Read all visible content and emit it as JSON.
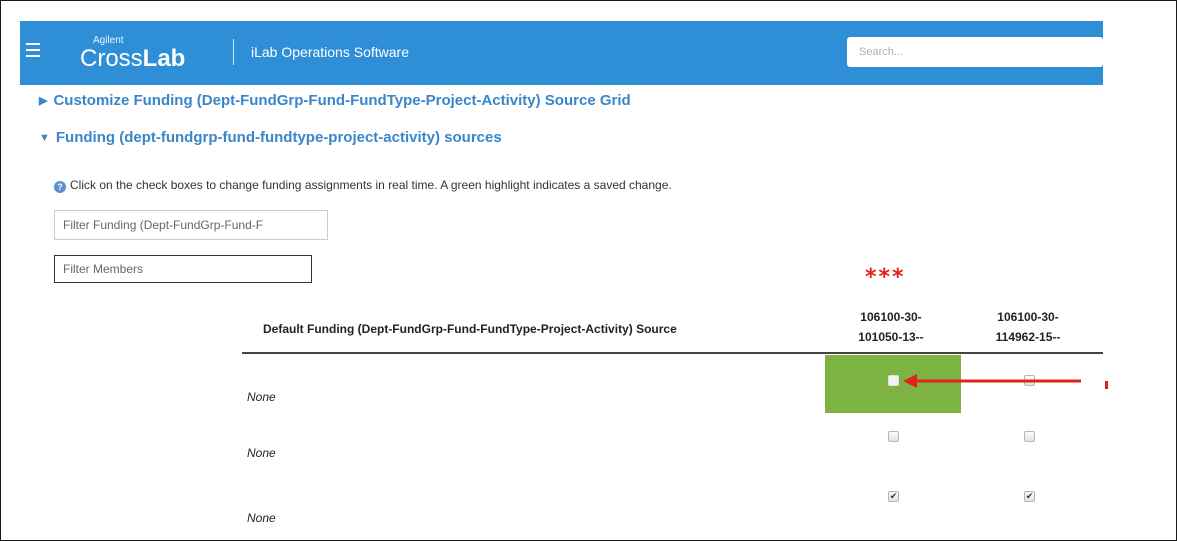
{
  "header": {
    "brand_small": "Agilent",
    "brand_cross": "Cross",
    "brand_lab": "Lab",
    "product": "iLab Operations Software",
    "search_placeholder": "Search..."
  },
  "sections": {
    "customize_link": "Customize Funding (Dept-FundGrp-Fund-FundType-Project-Activity) Source Grid",
    "customize_arrow": "▶",
    "sources_link": "Funding (dept-fundgrp-fund-fundtype-project-activity) sources",
    "sources_arrow": "▼"
  },
  "info": {
    "icon": "?",
    "text": "Click on the check boxes to change funding assignments in real time. A green highlight indicates a saved change."
  },
  "filters": {
    "funding_placeholder": "Filter Funding (Dept-FundGrp-Fund-F",
    "members_placeholder": "Filter Members"
  },
  "annotation": {
    "stars": "***",
    "accent_color": "#e4201b",
    "highlight_color": "#7cb342"
  },
  "grid": {
    "row_header": "Default Funding (Dept-FundGrp-Fund-FundType-Project-Activity) Source",
    "columns": [
      {
        "line1": "106100-30-",
        "line2": "101050-13--"
      },
      {
        "line1": "106100-30-",
        "line2": "114962-15--"
      }
    ],
    "rows": [
      {
        "label": "None",
        "checks": [
          false,
          false
        ],
        "saved": [
          true,
          false
        ]
      },
      {
        "label": "None",
        "checks": [
          false,
          false
        ],
        "saved": [
          false,
          false
        ]
      },
      {
        "label": "None",
        "checks": [
          true,
          true
        ],
        "saved": [
          false,
          false
        ]
      }
    ],
    "checkmark": "✔"
  },
  "icons": {
    "menu": "hamburger-menu-icon",
    "info": "info-icon",
    "arrow": "red-arrow-icon"
  }
}
